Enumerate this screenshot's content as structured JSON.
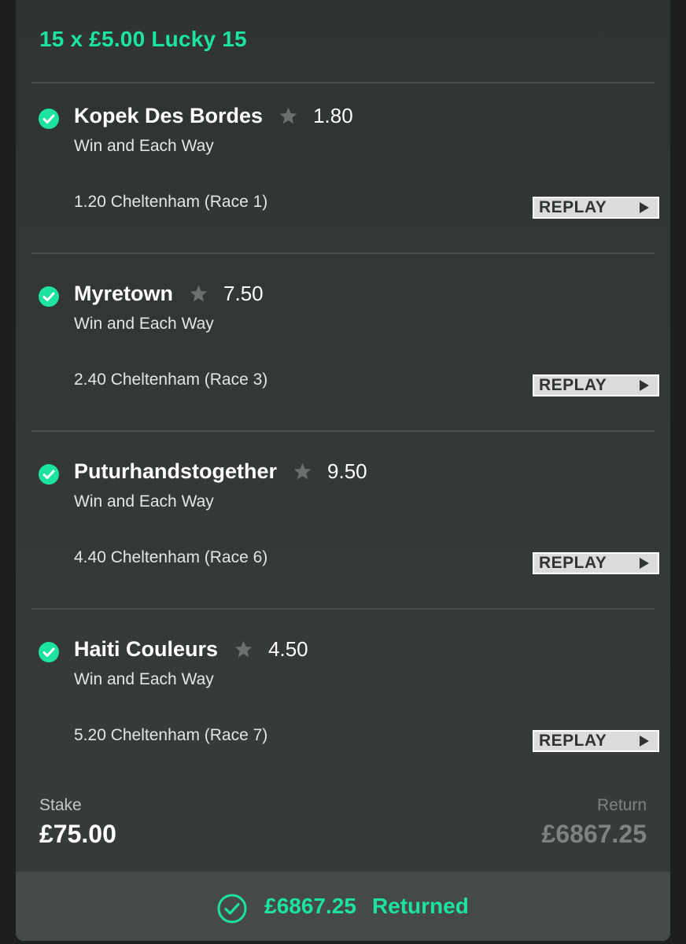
{
  "bet": {
    "title": "15 x £5.00 Lucky 15"
  },
  "selections": [
    {
      "name": "Kopek Des Bordes",
      "odds": "1.80",
      "market": "Win and Each Way",
      "event": "1.20 Cheltenham (Race 1)",
      "replay_label": "REPLAY",
      "status": "won"
    },
    {
      "name": "Myretown",
      "odds": "7.50",
      "market": "Win and Each Way",
      "event": "2.40 Cheltenham (Race 3)",
      "replay_label": "REPLAY",
      "status": "won"
    },
    {
      "name": "Puturhandstogether",
      "odds": "9.50",
      "market": "Win and Each Way",
      "event": "4.40 Cheltenham (Race 6)",
      "replay_label": "REPLAY",
      "status": "won"
    },
    {
      "name": "Haiti Couleurs",
      "odds": "4.50",
      "market": "Win and Each Way",
      "event": "5.20 Cheltenham (Race 7)",
      "replay_label": "REPLAY",
      "status": "won"
    }
  ],
  "summary": {
    "stake_label": "Stake",
    "stake_value": "£75.00",
    "return_label": "Return",
    "return_value": "£6867.25"
  },
  "footer": {
    "amount": "£6867.25",
    "status": "Returned"
  },
  "icons": {
    "selection_status": "check-circle-icon",
    "favourite": "star-icon",
    "replay": "play-icon",
    "footer": "check-circle-outline-icon"
  },
  "colors": {
    "accent": "#1ce3a0",
    "card_background": "#333735",
    "footer_background": "#454947",
    "star": "#6b6f6d",
    "muted_text": "#7e8381"
  }
}
